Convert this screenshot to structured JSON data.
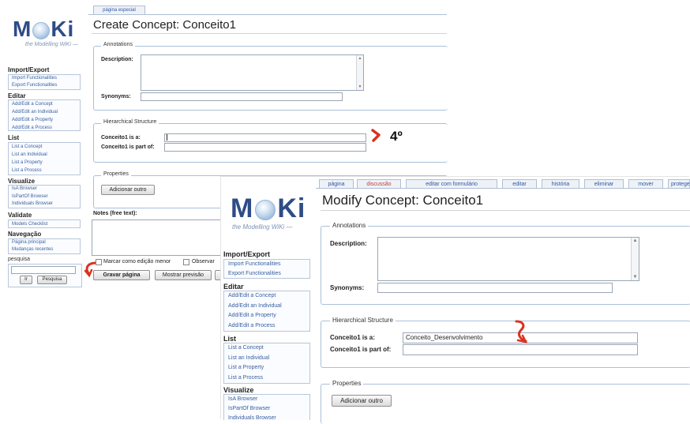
{
  "back": {
    "logo": {
      "word_left": "M",
      "word_right": "Ki",
      "tagline": "the Modelling WiKi —"
    },
    "tab_label": "página especial",
    "title": "Create Concept: Conceito1",
    "sidebar": {
      "import_export": {
        "title": "Import/Export",
        "items": [
          "Import Functionalities",
          "Export Functionalities"
        ]
      },
      "editar": {
        "title": "Editar",
        "items": [
          "Add/Edit a Concept",
          "Add/Edit an Individual",
          "Add/Edit a Property",
          "Add/Edit a Process"
        ]
      },
      "list": {
        "title": "List",
        "items": [
          "List a Concept",
          "List an Individual",
          "List a Property",
          "List a Process"
        ]
      },
      "visualize": {
        "title": "Visualize",
        "items": [
          "IsA Browser",
          "IsPartOf Browser",
          "Individuals Browser"
        ]
      },
      "validate": {
        "title": "Validate",
        "items": [
          "Models Checklist"
        ]
      },
      "navegacao": {
        "title": "Navegação",
        "items": [
          "Página principal",
          "Mudanças recentes"
        ]
      },
      "pesquisa": {
        "label": "pesquisa",
        "value": "",
        "ir": "Ir",
        "pesquisa_btn": "Pesquisa"
      }
    },
    "annotations": {
      "legend": "Annotations",
      "description_label": "Description:",
      "synonyms_label": "Synonyms:",
      "synonyms_value": ""
    },
    "hierarchy": {
      "legend": "Hierarchical Structure",
      "is_a_label": "Conceito1 is a:",
      "is_a_value": "",
      "part_of_label": "Conceito1 is part of:",
      "part_of_value": ""
    },
    "properties": {
      "legend": "Properties",
      "add_button": "Adicionar outro"
    },
    "notes_label": "Notes (free text):",
    "footer": {
      "minor_edit": "Marcar como edição menor",
      "watch": "Observar",
      "save": "Gravar página",
      "preview": "Mostrar previsão"
    },
    "step_marker": "4º"
  },
  "front": {
    "logo": {
      "word_left": "M",
      "word_right": "Ki",
      "tagline": "the Modelling WiKi —"
    },
    "tabs": [
      {
        "label": "página",
        "color": "#2f56a3"
      },
      {
        "label": "discussão",
        "color": "#c04040"
      },
      {
        "label": "editar com formulário",
        "color": "#2f56a3"
      },
      {
        "label": "editar",
        "color": "#2f56a3"
      },
      {
        "label": "história",
        "color": "#2f56a3"
      },
      {
        "label": "eliminar",
        "color": "#2f56a3"
      },
      {
        "label": "mover",
        "color": "#2f56a3"
      },
      {
        "label": "proteger",
        "color": "#2f56a3"
      }
    ],
    "title": "Modify Concept: Conceito1",
    "sidebar": {
      "import_export": {
        "title": "Import/Export",
        "items": [
          "Import Functionalities",
          "Export Functionalities"
        ]
      },
      "editar": {
        "title": "Editar",
        "items": [
          "Add/Edit a Concept",
          "Add/Edit an Individual",
          "Add/Edit a Property",
          "Add/Edit a Process"
        ]
      },
      "list": {
        "title": "List",
        "items": [
          "List a Concept",
          "List an Individual",
          "List a Property",
          "List a Process"
        ]
      },
      "visualize": {
        "title": "Visualize",
        "items": [
          "IsA Browser",
          "IsPartOf Browser",
          "Individuals Browser"
        ]
      }
    },
    "annotations": {
      "legend": "Annotations",
      "description_label": "Description:",
      "synonyms_label": "Synonyms:",
      "synonyms_value": ""
    },
    "hierarchy": {
      "legend": "Hierarchical Structure",
      "is_a_label": "Conceito1 is a:",
      "is_a_value": "Conceito_Desenvolvimento",
      "part_of_label": "Conceito1 is part of:",
      "part_of_value": ""
    },
    "properties": {
      "legend": "Properties",
      "add_button": "Adicionar outro"
    }
  },
  "colors": {
    "accent_arrow": "#d9331f",
    "link": "#3a5fa0",
    "border": "#aac0dc",
    "logo": "#2e4c87"
  }
}
